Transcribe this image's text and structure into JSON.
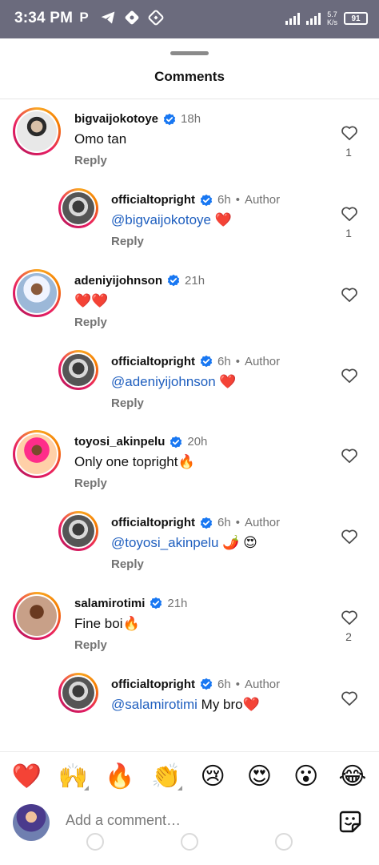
{
  "status_bar": {
    "time": "3:34 PM",
    "app_icons": [
      "p-icon",
      "telegram-icon",
      "app-icon-1",
      "app-icon-2"
    ],
    "net_speed_value": "5.7",
    "net_speed_unit": "K/s",
    "battery": "91"
  },
  "sheet": {
    "title": "Comments"
  },
  "common": {
    "reply_label": "Reply",
    "author_label": "Author",
    "dot": "•"
  },
  "comments": [
    {
      "user": "bigvaijokotoye",
      "time": "18h",
      "text": "Omo tan",
      "likes": "1",
      "reply": {
        "user": "officialtopright",
        "time": "6h",
        "mention": "@bigvaijokotoye",
        "text": " ❤️",
        "likes": "1"
      }
    },
    {
      "user": "adeniyijohnson",
      "time": "21h",
      "text": "❤️❤️",
      "likes": "",
      "reply": {
        "user": "officialtopright",
        "time": "6h",
        "mention": "@adeniyijohnson",
        "text": " ❤️",
        "likes": ""
      }
    },
    {
      "user": "toyosi_akinpelu",
      "time": "20h",
      "text": "Only one topright🔥",
      "likes": "",
      "reply": {
        "user": "officialtopright",
        "time": "6h",
        "mention": "@toyosi_akinpelu",
        "text": " 🌶️ 😍",
        "likes": ""
      }
    },
    {
      "user": "salamirotimi",
      "time": "21h",
      "text": "Fine boi🔥",
      "likes": "2",
      "reply": {
        "user": "officialtopright",
        "time": "6h",
        "mention": "@salamirotimi",
        "text": " My bro❤️",
        "likes": ""
      }
    }
  ],
  "emoji_bar": [
    "❤️",
    "🙌",
    "🔥",
    "👏",
    "😢",
    "😍",
    "😮",
    "😂"
  ],
  "composer": {
    "placeholder": "Add a comment…",
    "sticker_icon": "gif-sticker-icon"
  },
  "colors": {
    "mention": "#1f5fbf",
    "verified": "#1877f2",
    "muted": "#737373",
    "status_bar": "#6b6b7d"
  }
}
